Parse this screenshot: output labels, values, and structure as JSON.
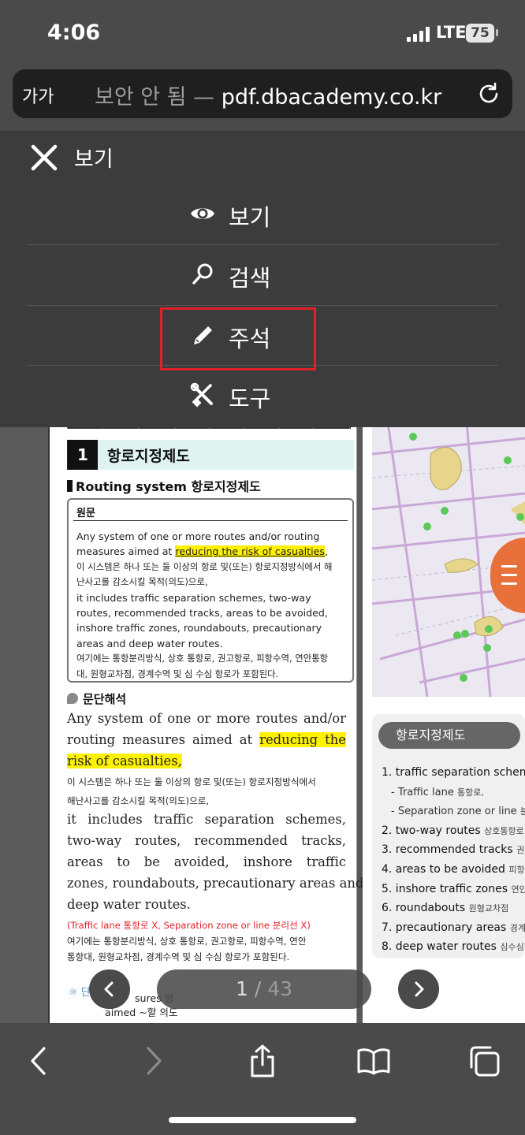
{
  "status_bar": {
    "time": "4:06",
    "network": "LTE",
    "battery": "75"
  },
  "browser": {
    "aa_label": "가가",
    "url_insecure_label": "보안 안 됨 —",
    "url_host": "pdf.dbacademy.co.kr",
    "reload_icon": "reload-icon"
  },
  "menu": {
    "title": "보기",
    "close_icon": "close-icon",
    "items": [
      {
        "label": "보기",
        "icon": "eye-icon"
      },
      {
        "label": "검색",
        "icon": "search-icon"
      },
      {
        "label": "주석",
        "icon": "pencil-icon",
        "highlighted": true
      },
      {
        "label": "도구",
        "icon": "tools-icon"
      }
    ],
    "highlight_color": "#e0202a"
  },
  "document": {
    "section": {
      "number": "1",
      "title": "항로지정제도"
    },
    "subheading": "Routing system 항로지정제도",
    "original": {
      "label": "원문",
      "lines": [
        "Any system of one or more routes and/or routing",
        "measures aimed at",
        "reducing the risk of casualties",
        ",",
        "이 시스템은 하나 또는 둘 이상의 항로 및(또는) 항로지정방식에서 해",
        "난사고를 감소시킬 목적(의도)으로,",
        "it includes traffic separation schemes, two-way",
        "routes, recommended tracks, areas to be avoided,",
        "inshore traffic zones, roundabouts, precautionary",
        "areas and deep water routes.",
        "여기에는 통항분리방식, 상호 통항로, 권고항로, 피항수역, 연안통항",
        "대, 원형교차점, 경계수역 및 심 수심 항로가 포함된다."
      ]
    },
    "interpretation": {
      "label": "문단해석",
      "lines": [
        "Any system of one or more routes and/or",
        "routing measures aimed at",
        "reducing the",
        "risk of casualties,",
        "이 시스템은 하나 또는 둘 이상의 항로 및(또는) 항로지정방식에서",
        "해난사고를 감소시킬 목적(의도)으로,",
        "it includes traffic separation schemes,",
        "two-way routes, recommended tracks,",
        "areas to be avoided, inshore traffic",
        "zones, roundabouts, precautionary areas and",
        "deep water routes.",
        "(Traffic lane 통항로 X, Separation zone or line 분리선 X)",
        "여기에는 통항분리방식, 상호 통항로, 권고항로, 피항수역, 연안",
        "통항대, 원형교차점, 경계수역 및 심 수심 항로가 포함된다."
      ]
    },
    "vocab": {
      "prefix": "단",
      "word_fragment": "sures 방",
      "note": "aimed ~할 의도"
    },
    "glossary": {
      "title": "항로지정제도",
      "items": [
        {
          "text": "1. traffic separation schemes",
          "note": ""
        },
        {
          "text": "- Traffic lane",
          "note": "통항로,",
          "sub": true
        },
        {
          "text": "- Separation zone or line",
          "note": "분",
          "sub": true
        },
        {
          "text": "2. two-way routes",
          "note": "상호통항로"
        },
        {
          "text": "3. recommended tracks",
          "note": "권고항"
        },
        {
          "text": "4. areas to be avoided",
          "note": "피항수역"
        },
        {
          "text": "5. inshore traffic zones",
          "note": "연안통"
        },
        {
          "text": "6. roundabouts",
          "note": "원형교차점"
        },
        {
          "text": "7. precautionary areas",
          "note": "경계수역"
        },
        {
          "text": "8. deep water routes",
          "note": "심수심항"
        }
      ]
    }
  },
  "pager": {
    "current": "1",
    "separator": "/",
    "total": "43",
    "prev_icon": "chevron-left-icon",
    "next_icon": "chevron-right-icon"
  },
  "toolbar": {
    "icons": [
      "back-icon",
      "forward-icon",
      "share-icon",
      "bookmarks-icon",
      "tabs-icon"
    ]
  }
}
